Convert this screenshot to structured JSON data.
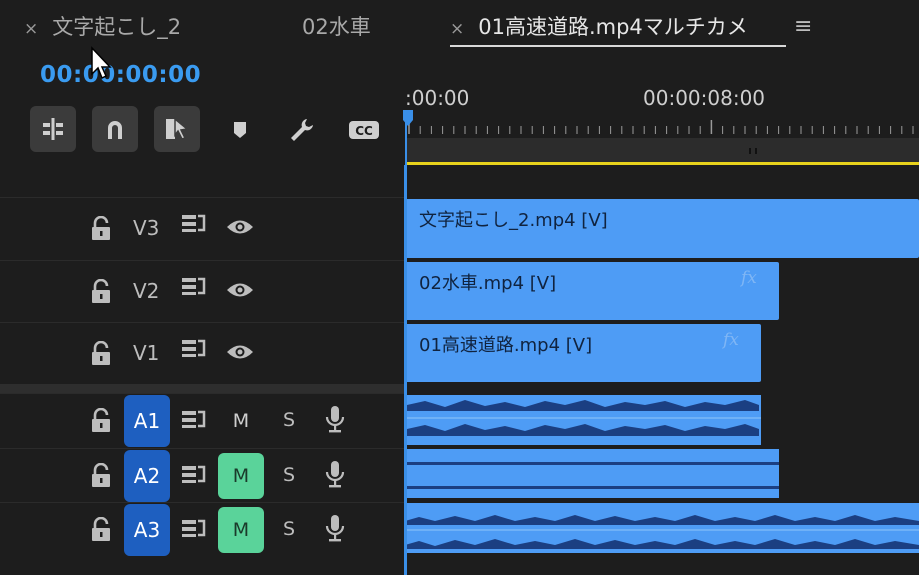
{
  "tabs": [
    {
      "label": "文字起こし_2",
      "has_close": true,
      "active": false
    },
    {
      "label": "02水車",
      "has_close": false,
      "active": false
    },
    {
      "label": "01高速道路.mp4マルチカメ",
      "has_close": true,
      "active": true
    }
  ],
  "close_glyph": "×",
  "panel_menu_glyph": "≡",
  "timecode": "00:00:00:00",
  "ruler": {
    "label_start": ":00:00",
    "label_mid": "00:00:08:00"
  },
  "video_tracks": [
    {
      "name": "V3"
    },
    {
      "name": "V2"
    },
    {
      "name": "V1"
    }
  ],
  "audio_tracks": [
    {
      "name": "A1",
      "mute": "M",
      "solo": "S",
      "mute_on": false
    },
    {
      "name": "A2",
      "mute": "M",
      "solo": "S",
      "mute_on": true
    },
    {
      "name": "A3",
      "mute": "M",
      "solo": "S",
      "mute_on": true
    }
  ],
  "clips": {
    "v3": "文字起こし_2.mp4 [V]",
    "v2": "02水車.mp4 [V]",
    "v1": "01高速道路.mp4 [V]",
    "fx": "fx"
  },
  "tools": [
    "insert-sequence-icon",
    "snap-icon",
    "linked-selection-icon",
    "add-marker-icon",
    "wrench-icon",
    "captions-icon"
  ],
  "colors": {
    "accent": "#3a9bf0",
    "clip": "#4e9cf5",
    "mute_on": "#5ad39a",
    "track_badge": "#1e5fc0",
    "work_area": "#e8d21c"
  }
}
